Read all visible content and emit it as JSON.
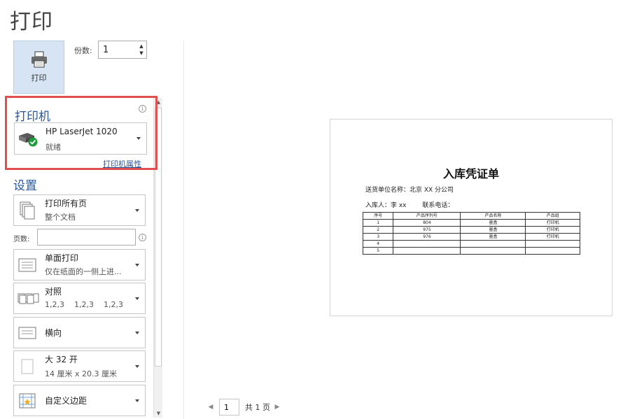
{
  "page": {
    "title": "打印"
  },
  "print_button": {
    "label": "打印"
  },
  "copies": {
    "label": "份数:",
    "value": "1"
  },
  "printer": {
    "heading": "打印机",
    "name": "HP LaserJet 1020",
    "status": "就绪",
    "properties_link": "打印机属性"
  },
  "settings": {
    "heading": "设置",
    "print_range": {
      "main": "打印所有页",
      "sub": "整个文档"
    },
    "pages": {
      "label": "页数:",
      "value": ""
    },
    "sides": {
      "main": "单面打印",
      "sub": "仅在纸面的一侧上进..."
    },
    "collation": {
      "main": "对照",
      "sub": "1,2,3    1,2,3    1,2,3"
    },
    "orientation": {
      "main": "横向"
    },
    "paper_size": {
      "main": "大 32 开",
      "sub": "14 厘米 x 20.3 厘米"
    },
    "margins": {
      "main": "自定义边距"
    }
  },
  "preview": {
    "title": "入库凭证单",
    "supplier": "送货单位名称：北京 XX 分公司",
    "receiver": "入库人：李 xx        联系电话：",
    "table": {
      "headers": [
        "序号",
        "产品序列号",
        "产品名称",
        "产品组"
      ],
      "rows": [
        [
          "1",
          "804",
          "墨盒",
          "打印机"
        ],
        [
          "2",
          "975",
          "墨盒",
          "打印机"
        ],
        [
          "3",
          "976",
          "墨盒",
          "打印机"
        ],
        [
          "4",
          "",
          "",
          ""
        ],
        [
          "5",
          "",
          "",
          ""
        ]
      ]
    }
  },
  "pager": {
    "current": "1",
    "total_text": "共 1 页"
  }
}
